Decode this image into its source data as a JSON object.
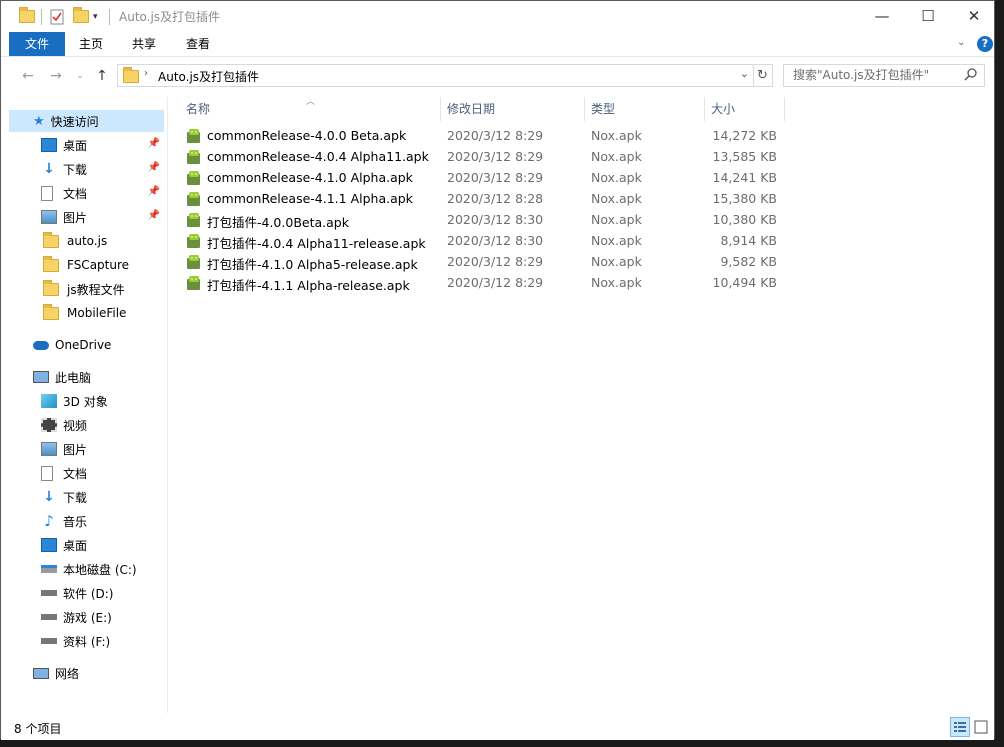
{
  "window": {
    "title": "Auto.js及打包插件",
    "controls": {
      "minimize": "—",
      "maximize": "☐",
      "close": "✕"
    }
  },
  "ribbon": {
    "tabs": [
      "文件",
      "主页",
      "共享",
      "查看"
    ],
    "expand_icon": "chevron-down-icon",
    "help_icon": "?"
  },
  "address": {
    "path": "Auto.js及打包插件",
    "search_placeholder": "搜索\"Auto.js及打包插件\""
  },
  "sidebar": {
    "quick_access": "快速访问",
    "quick_items": [
      "桌面",
      "下载",
      "文档",
      "图片",
      "auto.js",
      "FSCapture",
      "js教程文件",
      "MobileFile"
    ],
    "onedrive": "OneDrive",
    "this_pc": "此电脑",
    "pc_items": [
      "3D 对象",
      "视频",
      "图片",
      "文档",
      "下载",
      "音乐",
      "桌面",
      "本地磁盘 (C:)",
      "软件 (D:)",
      "游戏 (E:)",
      "资料 (F:)"
    ],
    "network": "网络"
  },
  "columns": {
    "name": "名称",
    "date": "修改日期",
    "type": "类型",
    "size": "大小"
  },
  "files": [
    {
      "name": "commonRelease-4.0.0 Beta.apk",
      "date": "2020/3/12 8:29",
      "type": "Nox.apk",
      "size": "14,272 KB"
    },
    {
      "name": "commonRelease-4.0.4 Alpha11.apk",
      "date": "2020/3/12 8:29",
      "type": "Nox.apk",
      "size": "13,585 KB"
    },
    {
      "name": "commonRelease-4.1.0 Alpha.apk",
      "date": "2020/3/12 8:29",
      "type": "Nox.apk",
      "size": "14,241 KB"
    },
    {
      "name": "commonRelease-4.1.1 Alpha.apk",
      "date": "2020/3/12 8:28",
      "type": "Nox.apk",
      "size": "15,380 KB"
    },
    {
      "name": "打包插件-4.0.0Beta.apk",
      "date": "2020/3/12 8:30",
      "type": "Nox.apk",
      "size": "10,380 KB"
    },
    {
      "name": "打包插件-4.0.4 Alpha11-release.apk",
      "date": "2020/3/12 8:30",
      "type": "Nox.apk",
      "size": "8,914 KB"
    },
    {
      "name": "打包插件-4.1.0 Alpha5-release.apk",
      "date": "2020/3/12 8:29",
      "type": "Nox.apk",
      "size": "9,582 KB"
    },
    {
      "name": "打包插件-4.1.1 Alpha-release.apk",
      "date": "2020/3/12 8:29",
      "type": "Nox.apk",
      "size": "10,494 KB"
    }
  ],
  "status": {
    "count": "8 个项目"
  },
  "colors": {
    "accent": "#1a6ec2",
    "selection": "#cce8ff",
    "header_text": "#4c607a"
  }
}
